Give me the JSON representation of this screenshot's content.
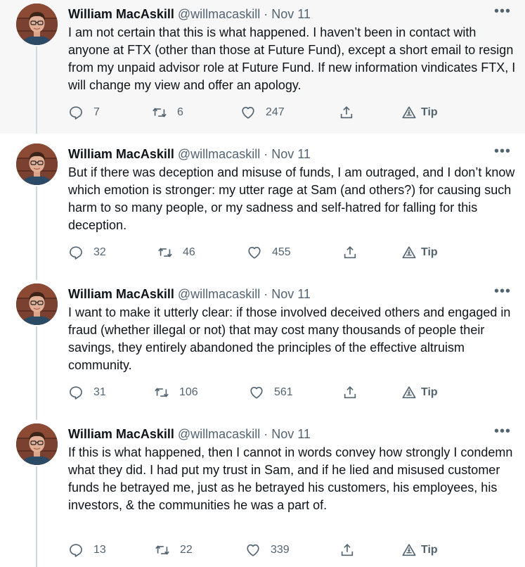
{
  "author": {
    "name": "William MacAskill",
    "handle": "@willmacaskill",
    "separator": "·"
  },
  "more_label": "•••",
  "tip_label": "Tip",
  "tweets": [
    {
      "date": "Nov 11",
      "text": "I am not certain that this is what happened. I haven’t been in contact with anyone at FTX (other than those at Future Fund), except a short email to resign from my unpaid advisor role at Future Fund. If new information vindicates FTX, I will change my view and offer an apology.",
      "replies": "7",
      "retweets": "6",
      "likes": "247"
    },
    {
      "date": "Nov 11",
      "text": "But if there was deception and misuse of funds, I am outraged, and I don’t know which emotion is stronger: my utter rage at Sam (and others?) for causing such harm to so many people, or my sadness and self-hatred for falling for this deception.",
      "replies": "32",
      "retweets": "46",
      "likes": "455"
    },
    {
      "date": "Nov 11",
      "text": "I want to make it utterly clear: if those involved deceived others and engaged in fraud (whether illegal or not) that may cost many thousands of people their savings, they entirely abandoned the principles of the effective altruism community.",
      "replies": "31",
      "retweets": "106",
      "likes": "561"
    },
    {
      "date": "Nov 11",
      "text": "If this is what happened, then I cannot in words convey how strongly I condemn what they did. I had put my trust in Sam, and if he lied and misused customer funds he betrayed me, just as he betrayed his customers, his employees, his investors, & the communities he was a part of.",
      "replies": "13",
      "retweets": "22",
      "likes": "339"
    }
  ],
  "icons": {
    "reply": "reply-icon",
    "retweet": "retweet-icon",
    "like": "heart-icon",
    "share": "share-icon",
    "tip": "tip-icon"
  },
  "colors": {
    "text": "#0f1419",
    "secondary": "#536471",
    "thread_line": "#cfd9de",
    "shaded_background": "#f7f7f7"
  }
}
